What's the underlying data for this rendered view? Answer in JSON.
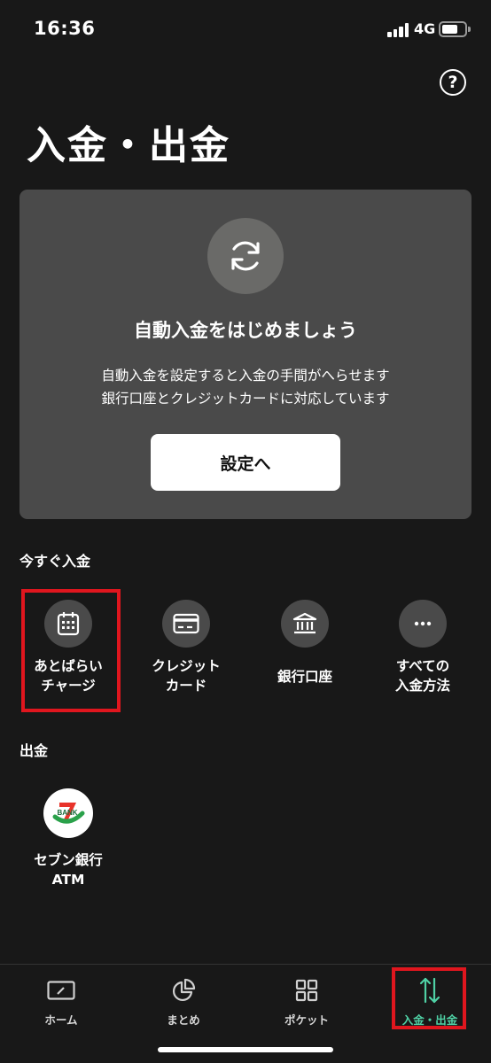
{
  "status_bar": {
    "time": "16:36",
    "network": "4G"
  },
  "header": {
    "title": "入金・出金",
    "help_icon": "question-circle-icon",
    "help_label": "?"
  },
  "auto_deposit": {
    "icon": "refresh-icon",
    "title": "自動入金をはじめましょう",
    "line1": "自動入金を設定すると入金の手間がへらせます",
    "line2": "銀行口座とクレジットカードに対応しています",
    "button_label": "設定へ"
  },
  "deposit_section": {
    "label": "今すぐ入金",
    "methods": [
      {
        "icon": "calendar-icon",
        "line1": "あとばらい",
        "line2": "チャージ",
        "highlighted": true
      },
      {
        "icon": "credit-card-icon",
        "line1": "クレジット",
        "line2": "カード"
      },
      {
        "icon": "bank-icon",
        "line1": "銀行口座",
        "line2": ""
      },
      {
        "icon": "more-icon",
        "line1": "すべての",
        "line2": "入金方法"
      }
    ]
  },
  "withdraw_section": {
    "label": "出金",
    "methods": [
      {
        "icon": "seven-bank-logo",
        "logo_text": "BANK",
        "line1": "セブン銀行",
        "line2": "ATM"
      }
    ]
  },
  "tab_bar": {
    "tabs": [
      {
        "icon": "home-icon",
        "label": "ホーム"
      },
      {
        "icon": "pie-chart-icon",
        "label": "まとめ"
      },
      {
        "icon": "grid-icon",
        "label": "ポケット"
      },
      {
        "icon": "arrows-updown-icon",
        "label": "入金・出金",
        "active": true
      }
    ]
  },
  "colors": {
    "background": "#181818",
    "card": "#4a4a4a",
    "accent": "#4fd1a5",
    "highlight": "#e0161e"
  }
}
